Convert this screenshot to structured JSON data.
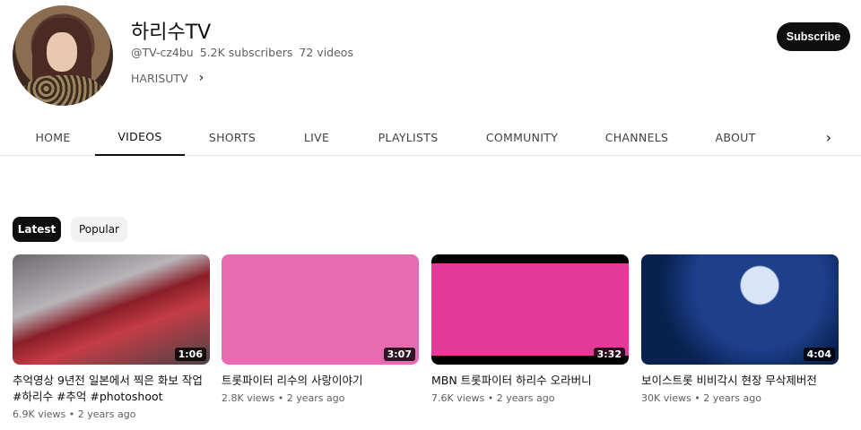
{
  "channel": {
    "name": "하리수TV",
    "handle": "@TV-cz4bu",
    "subscribers": "5.2K subscribers",
    "videos": "72 videos",
    "link": "HARISUTV",
    "subscribe_label": "Subscribe"
  },
  "tabs": [
    "HOME",
    "VIDEOS",
    "SHORTS",
    "LIVE",
    "PLAYLISTS",
    "COMMUNITY",
    "CHANNELS",
    "ABOUT"
  ],
  "active_tab": "VIDEOS",
  "chips": [
    "Latest",
    "Popular"
  ],
  "active_chip": "Latest",
  "videos": [
    {
      "title": "추억영상 9년전 일본에서 찍은 화보 작업 #하리수 #추억 #photoshoot",
      "duration": "1:06",
      "views": "6.9K views",
      "age": "2 years ago"
    },
    {
      "title": "트롯파이터 리수의 사랑이야기",
      "duration": "3:07",
      "views": "2.8K views",
      "age": "2 years ago"
    },
    {
      "title": "MBN 트롯파이터 하리수 오라버니",
      "duration": "3:32",
      "views": "7.6K views",
      "age": "2 years ago"
    },
    {
      "title": "보이스트롯 비비각시 현장 무삭제버전",
      "duration": "4:04",
      "views": "30K views",
      "age": "2 years ago"
    }
  ],
  "colors": {
    "primary": "#0f0f0f",
    "secondary_text": "#606060",
    "chip_inactive": "#f2f2f2"
  }
}
